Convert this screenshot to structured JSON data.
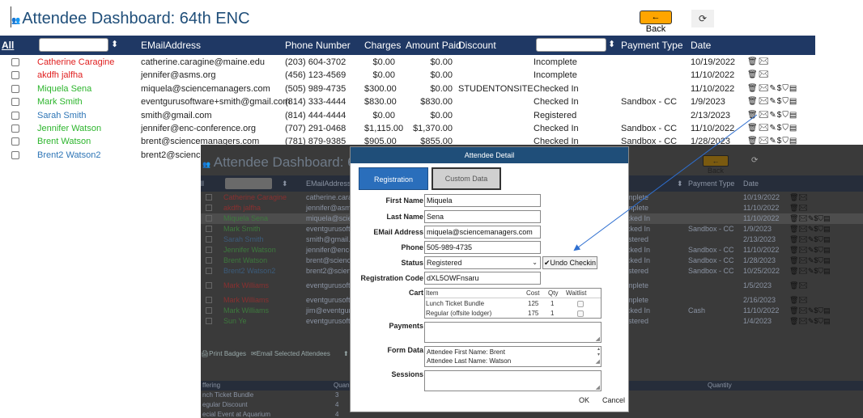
{
  "page": {
    "title": "Attendee Dashboard: 64th ENC",
    "back_label": "← Back",
    "refresh_icon": "refresh-icon"
  },
  "grid": {
    "all_label": "All",
    "headers": [
      "EMailAddress",
      "Phone Number",
      "Charges",
      "Amount Paid",
      "Discount",
      "Payment Type",
      "Date"
    ],
    "rows": [
      {
        "name": "Catherine Caragine",
        "color": "#e02020",
        "email": "catherine.caragine@maine.edu",
        "phone": "(203) 604-3702",
        "charges": "$0.00",
        "paid": "$0.00",
        "discount": "",
        "status": "Incomplete",
        "payment": "",
        "date": "10/19/2022",
        "actions": "🗑✉"
      },
      {
        "name": "akdfh jalfha",
        "color": "#e02020",
        "email": "jennifer@asms.org",
        "phone": "(456) 123-4569",
        "charges": "$0.00",
        "paid": "$0.00",
        "discount": "",
        "status": "Incomplete",
        "payment": "",
        "date": "11/10/2022",
        "actions": "🗑✉"
      },
      {
        "name": "Miquela Sena",
        "color": "#2db52d",
        "email": "miquela@sciencemanagers.com",
        "phone": "(505) 989-4735",
        "charges": "$300.00",
        "paid": "$0.00",
        "discount": "STUDENTONSITE",
        "status": "Checked In",
        "payment": "",
        "date": "11/10/2022",
        "actions": "🗑✉✎$⛉▤"
      },
      {
        "name": "Mark Smith",
        "color": "#2db52d",
        "email": "eventgurusoftware+smith@gmail.com",
        "phone": "(814) 333-4444",
        "charges": "$830.00",
        "paid": "$830.00",
        "discount": "",
        "status": "Checked In",
        "payment": "Sandbox - CC",
        "date": "1/9/2023",
        "actions": "🗑✉✎$⛉▤"
      },
      {
        "name": "Sarah Smith",
        "color": "#2e75b6",
        "email": "smith@gmail.com",
        "phone": "(814) 444-4444",
        "charges": "$0.00",
        "paid": "$0.00",
        "discount": "",
        "status": "Registered",
        "payment": "",
        "date": "2/13/2023",
        "actions": "🗑✉✎$⛉▤"
      },
      {
        "name": "Jennifer Watson",
        "color": "#2db52d",
        "email": "jennifer@enc-conference.org",
        "phone": "(707) 291-0468",
        "charges": "$1,115.00",
        "paid": "$1,370.00",
        "discount": "",
        "status": "Checked In",
        "payment": "Sandbox - CC",
        "date": "11/10/2022",
        "actions": "🗑✉✎$⛉▤"
      },
      {
        "name": "Brent Watson",
        "color": "#2db52d",
        "email": "brent@sciencemanagers.com",
        "phone": "(781) 879-9385",
        "charges": "$905.00",
        "paid": "$855.00",
        "discount": "",
        "status": "Checked In",
        "payment": "Sandbox - CC",
        "date": "1/28/2023",
        "actions": "🗑✉✎$⛉▤"
      },
      {
        "name": "Brent2 Watson2",
        "color": "#2e75b6",
        "email": "brent2@science",
        "phone": "",
        "charges": "",
        "paid": "",
        "discount": "",
        "status": "",
        "payment": "",
        "date": "",
        "actions": ""
      }
    ]
  },
  "bg": {
    "title": "Attendee Dashboard: 64",
    "back_label": "Back",
    "headers": [
      "EMailAddress",
      "Payment Type",
      "Date"
    ],
    "rows": [
      {
        "name": "Catherine Caragine",
        "color": "#8a3030",
        "email": "catherine.cara",
        "status": "mplete",
        "payment": "",
        "date": "10/19/2022",
        "actions": "🗑✉"
      },
      {
        "name": "akdfh jalfha",
        "color": "#8a3030",
        "email": "jennifer@asm",
        "status": "mplete",
        "payment": "",
        "date": "11/10/2022",
        "actions": "🗑✉"
      },
      {
        "name": "Miquela Sena",
        "color": "#3d7a3d",
        "email": "miquela@scie",
        "status": "cked In",
        "payment": "",
        "date": "11/10/2022",
        "actions": "🗑✉✎$⛉▤"
      },
      {
        "name": "Mark Smith",
        "color": "#3d7a3d",
        "email": "eventgurusoftw",
        "status": "cked In",
        "payment": "Sandbox - CC",
        "date": "1/9/2023",
        "actions": "🗑✉✎$⛉▤"
      },
      {
        "name": "Sarah Smith",
        "color": "#3c5c7c",
        "email": "smith@gmail.c",
        "status": "istered",
        "payment": "",
        "date": "2/13/2023",
        "actions": "🗑✉✎$⛉▤"
      },
      {
        "name": "Jennifer Watson",
        "color": "#3d7a3d",
        "email": "jennifer@enc-",
        "status": "cked In",
        "payment": "Sandbox - CC",
        "date": "11/10/2022",
        "actions": "🗑✉✎$⛉▤"
      },
      {
        "name": "Brent Watson",
        "color": "#3d7a3d",
        "email": "brent@science",
        "status": "cked In",
        "payment": "Sandbox - CC",
        "date": "1/28/2023",
        "actions": "🗑✉✎$⛉▤"
      },
      {
        "name": "Brent2 Watson2",
        "color": "#3c5c7c",
        "email": "brent2@scienc",
        "status": "istered",
        "payment": "Sandbox - CC",
        "date": "10/25/2022",
        "actions": "🗑✉✎$⛉▤"
      },
      {
        "name": "Mark Williams",
        "color": "#8a3030",
        "email": "eventgurusoftv",
        "status": "mplete",
        "payment": "",
        "date": "1/5/2023",
        "actions": "🗑✉"
      },
      {
        "name": "Mark Williams",
        "color": "#8a3030",
        "email": "eventgurusoftv",
        "status": "mplete",
        "payment": "",
        "date": "2/16/2023",
        "actions": "🗑✉"
      },
      {
        "name": "Mark Williams",
        "color": "#3d7a3d",
        "email": "jim@eventguri",
        "status": "cked In",
        "payment": "Cash",
        "date": "11/10/2022",
        "actions": "🗑✉✎$⛉▤"
      },
      {
        "name": "Sun Ye",
        "color": "#3d7a3d",
        "email": "eventgurusoftv",
        "status": "istered",
        "payment": "",
        "date": "1/4/2023",
        "actions": "🗑✉✎$⛉▤"
      }
    ],
    "print_badges": "Print Badges",
    "email_selected": "Email Selected Attendees",
    "offering_header": "ffering",
    "quantity_header": "Quan",
    "quantity_header2": "Quantity",
    "offerings": [
      {
        "name": "nch Ticket Bundle",
        "qty": "3"
      },
      {
        "name": "egular Discount",
        "qty": "4"
      },
      {
        "name": "ecial Event at Aquarium",
        "qty": "4"
      }
    ]
  },
  "modal": {
    "title": "Attendee Detail",
    "tab_registration": "Registration",
    "tab_custom": "Custom Data",
    "labels": {
      "first_name": "First Name",
      "last_name": "Last Name",
      "email": "EMail Address",
      "phone": "Phone",
      "status": "Status",
      "reg_code": "Registration Code",
      "cart": "Cart",
      "payments": "Payments",
      "form_data": "Form Data",
      "sessions": "Sessions"
    },
    "values": {
      "first_name": "Miquela",
      "last_name": "Sena",
      "email": "miquela@sciencemanagers.com",
      "phone": "505-989-4735",
      "status": "Registered",
      "reg_code": "dXL5OWFnsaru"
    },
    "undo_checkin": "✔Undo Checkin",
    "cart": {
      "headers": [
        "Item",
        "Cost",
        "Qty",
        "Waitlist"
      ],
      "items": [
        {
          "item": "Lunch Ticket Bundle",
          "cost": "125",
          "qty": "1"
        },
        {
          "item": "Regular (offsite lodger)",
          "cost": "175",
          "qty": "1"
        }
      ]
    },
    "form_data_lines": [
      "Attendee First Name: Brent",
      "Attendee Last Name: Watson"
    ],
    "ok_label": "OK",
    "cancel_label": "Cancel"
  }
}
